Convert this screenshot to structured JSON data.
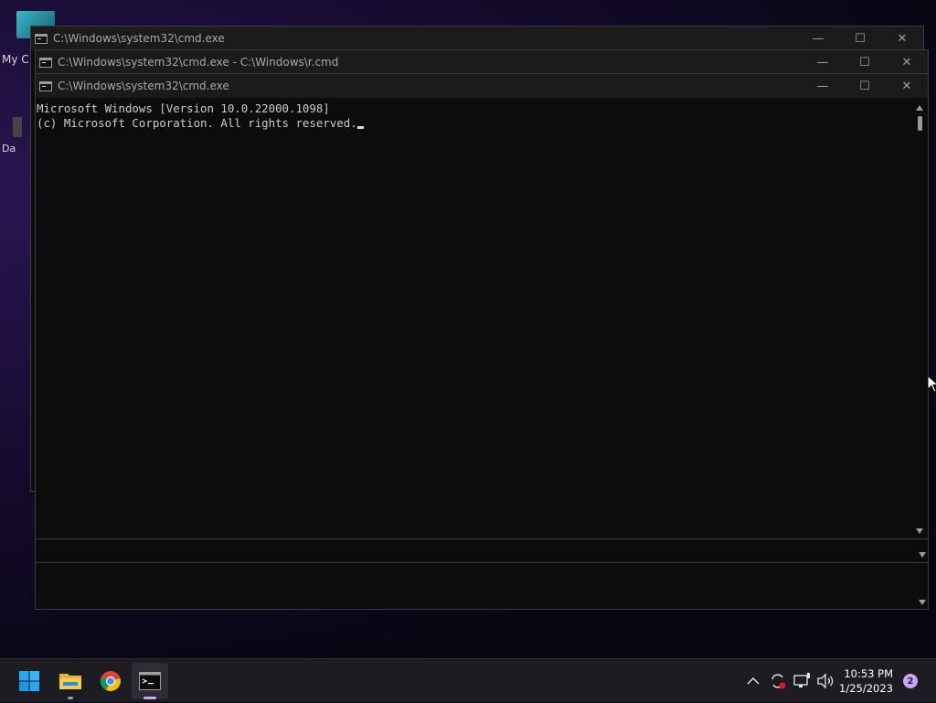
{
  "desktop": {
    "label_1": "My C",
    "label_2": "Da"
  },
  "windows": [
    {
      "title": "C:\\Windows\\system32\\cmd.exe"
    },
    {
      "title": "C:\\Windows\\system32\\cmd.exe - C:\\Windows\\r.cmd"
    },
    {
      "title": "C:\\Windows\\system32\\cmd.exe"
    }
  ],
  "window_controls": {
    "minimize": "—",
    "maximize": "☐",
    "close": "✕"
  },
  "console": {
    "line_1": "Microsoft Windows [Version 10.0.22000.1098]",
    "line_2": "(c) Microsoft Corporation. All rights reserved."
  },
  "taskbar": {
    "apps": [
      "start",
      "file-explorer",
      "chrome",
      "command-prompt"
    ],
    "time": "10:53 PM",
    "date": "1/25/2023",
    "notification_count": "2"
  }
}
